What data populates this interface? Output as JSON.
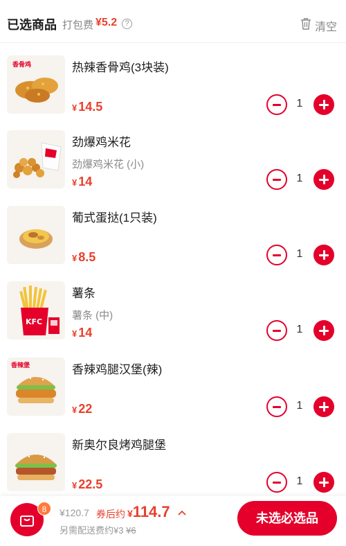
{
  "header": {
    "title": "已选商品",
    "pack_label": "打包费",
    "pack_fee": "¥5.2",
    "help_glyph": "?",
    "clear_label": "清空"
  },
  "items": [
    {
      "name": "热辣香骨鸡(3块装)",
      "spec": "",
      "yen": "¥",
      "price": "14.5",
      "qty": "1",
      "image": "spicy-chicken-image"
    },
    {
      "name": "劲爆鸡米花",
      "spec": "劲爆鸡米花 (小)",
      "yen": "¥",
      "price": "14",
      "qty": "1",
      "image": "popcorn-chicken-image"
    },
    {
      "name": "葡式蛋挞(1只装)",
      "spec": "",
      "yen": "¥",
      "price": "8.5",
      "qty": "1",
      "image": "egg-tart-image"
    },
    {
      "name": "薯条",
      "spec": "薯条 (中)",
      "yen": "¥",
      "price": "14",
      "qty": "1",
      "image": "fries-image"
    },
    {
      "name": "香辣鸡腿汉堡(辣)",
      "spec": "",
      "yen": "¥",
      "price": "22",
      "qty": "1",
      "image": "spicy-burger-image"
    },
    {
      "name": "新奥尔良烤鸡腿堡",
      "spec": "",
      "yen": "¥",
      "price": "22.5",
      "qty": "1",
      "image": "orleans-burger-image"
    }
  ],
  "footer": {
    "cart_count": "8",
    "original_total": "¥120.7",
    "coupon_label": "券后约",
    "final_yen": "¥",
    "final_total": "114.7",
    "delivery_prefix": "另需配送费约¥3",
    "delivery_original": "¥6",
    "checkout_label": "未选必选品"
  },
  "colors": {
    "brand_red": "#e4002b",
    "price_red": "#e8402c",
    "badge_orange": "#ff7a3d"
  }
}
